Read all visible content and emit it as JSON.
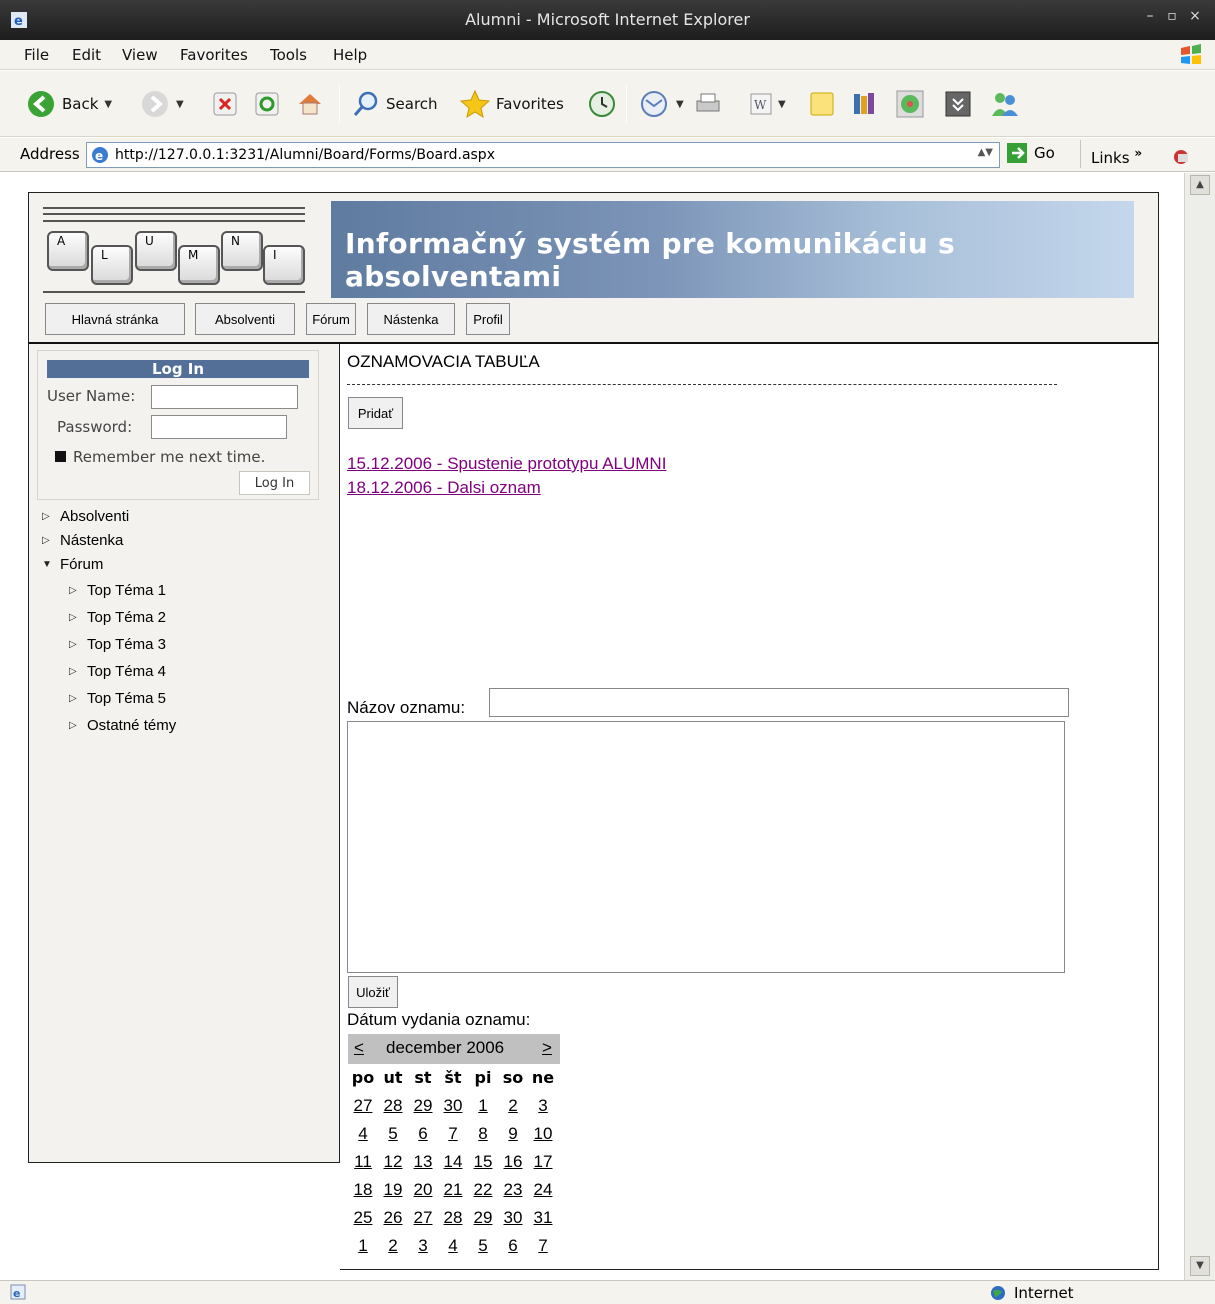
{
  "window": {
    "title": "Alumni - Microsoft Internet Explorer"
  },
  "menu": [
    "File",
    "Edit",
    "View",
    "Favorites",
    "Tools",
    "Help"
  ],
  "toolbar": {
    "back": "Back",
    "search": "Search",
    "favorites": "Favorites"
  },
  "address": {
    "label": "Address",
    "url": "http://127.0.0.1:3231/Alumni/Board/Forms/Board.aspx",
    "go": "Go",
    "links": "Links"
  },
  "status": {
    "zone": "Internet"
  },
  "logo": {
    "keys": [
      "A",
      "L",
      "U",
      "M",
      "N",
      "I"
    ]
  },
  "banner": {
    "text": "Informačný systém pre komunikáciu s absolventami"
  },
  "nav": [
    "Hlavná stránka",
    "Absolventi",
    "Fórum",
    "Nástenka",
    "Profil"
  ],
  "login": {
    "title": "Log In",
    "user_label": "User Name:",
    "password_label": "Password:",
    "remember": "Remember me next time.",
    "button": "Log In"
  },
  "tree": {
    "top": [
      "Absolventi",
      "Nástenka",
      "Fórum"
    ],
    "forum_children": [
      "Top Téma 1",
      "Top Téma 2",
      "Top Téma 3",
      "Top Téma 4",
      "Top Téma 5",
      "Ostatné témy"
    ]
  },
  "main": {
    "title": "OZNAMOVACIA TABUĽA",
    "add_button": "Pridať",
    "news": [
      "15.12.2006 - Spustenie prototypu ALUMNI",
      "18.12.2006 - Dalsi oznam"
    ],
    "name_label": "Názov oznamu:",
    "save_button": "Uložiť",
    "date_label": "Dátum vydania oznamu:"
  },
  "calendar": {
    "prev": "<",
    "next": ">",
    "month": "december 2006",
    "dow": [
      "po",
      "ut",
      "st",
      "št",
      "pi",
      "so",
      "ne"
    ],
    "weeks": [
      [
        "27",
        "28",
        "29",
        "30",
        "1",
        "2",
        "3"
      ],
      [
        "4",
        "5",
        "6",
        "7",
        "8",
        "9",
        "10"
      ],
      [
        "11",
        "12",
        "13",
        "14",
        "15",
        "16",
        "17"
      ],
      [
        "18",
        "19",
        "20",
        "21",
        "22",
        "23",
        "24"
      ],
      [
        "25",
        "26",
        "27",
        "28",
        "29",
        "30",
        "31"
      ],
      [
        "1",
        "2",
        "3",
        "4",
        "5",
        "6",
        "7"
      ]
    ]
  },
  "colors": {
    "banner_start": "#5f7ba0",
    "banner_end": "#c4d7ec",
    "login_header": "#536f98",
    "visited_link": "#800080"
  }
}
